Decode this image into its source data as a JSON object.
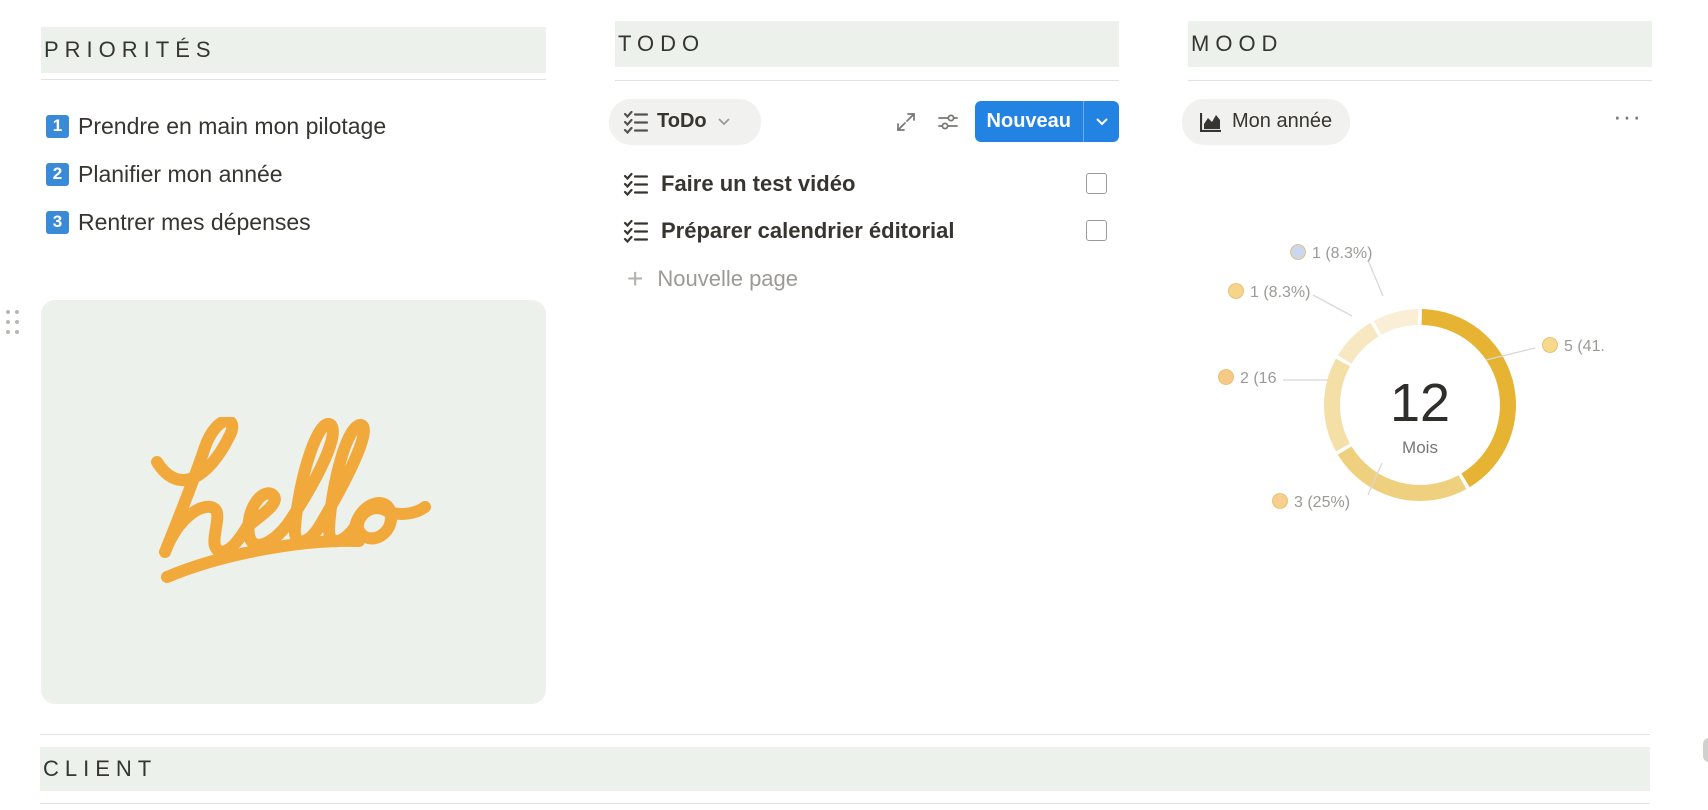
{
  "priorities": {
    "title": "PRIORITÉS",
    "items": [
      {
        "num": "1",
        "label": "Prendre en main mon pilotage"
      },
      {
        "num": "2",
        "label": "Planifier mon année"
      },
      {
        "num": "3",
        "label": "Rentrer mes dépenses"
      }
    ]
  },
  "hello_card": {
    "text": "hello"
  },
  "todo": {
    "title": "TODO",
    "view_label": "ToDo",
    "new_button_label": "Nouveau",
    "tasks": [
      {
        "label": "Faire un test vidéo",
        "checked": false
      },
      {
        "label": "Préparer calendrier éditorial",
        "checked": false
      }
    ],
    "new_page_label": "Nouvelle page"
  },
  "mood": {
    "title": "MOOD",
    "view_label": "Mon année",
    "center_value": "12",
    "center_label": "Mois",
    "labels": [
      {
        "text": "5 (41.",
        "icon": "party-face-icon"
      },
      {
        "text": "3 (25%)",
        "icon": "sleepy-face-icon"
      },
      {
        "text": "2 (16",
        "icon": "neutral-face-icon"
      },
      {
        "text": "1 (8.3%)",
        "icon": "grimacing-face-icon"
      },
      {
        "text": "1 (8.3%)",
        "icon": "screaming-face-icon"
      }
    ]
  },
  "chart_data": {
    "type": "pie",
    "donut": true,
    "total": 12,
    "total_label": "Mois",
    "slices": [
      {
        "value": 5,
        "percent": 41.7,
        "color": "#e6b333"
      },
      {
        "value": 3,
        "percent": 25,
        "color": "#efd07f"
      },
      {
        "value": 2,
        "percent": 16.7,
        "color": "#f4dfa6"
      },
      {
        "value": 1,
        "percent": 8.3,
        "color": "#f8e8c2"
      },
      {
        "value": 1,
        "percent": 8.3,
        "color": "#faefd6"
      }
    ]
  },
  "client": {
    "title": "CLIENT"
  },
  "colors": {
    "accent_blue": "#2383e2",
    "section_bg": "#ecf1eb",
    "hello_orange": "#f2a93b"
  }
}
